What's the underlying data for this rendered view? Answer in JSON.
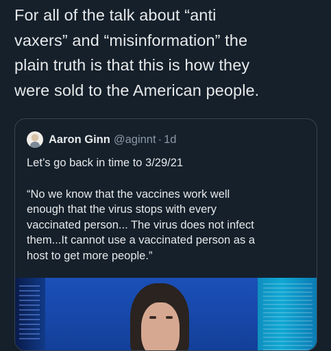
{
  "tweet": {
    "text_lines": [
      "For all of the talk about “anti",
      "vaxers” and “misinformation” the",
      "plain truth is that this is how they",
      "were sold to the American people."
    ]
  },
  "quoted_tweet": {
    "author_name": "Aaron Ginn",
    "author_handle": "@aginnt",
    "separator": "·",
    "time": "1d",
    "line1": "Let’s go back in time to 3/29/21",
    "body_lines": [
      "“No we know that the vaccines work well",
      "enough that the virus stops with every",
      "vaccinated person... The virus does not infect",
      "them...It cannot use a vaccinated person as a",
      "host to get more people.”"
    ]
  },
  "colors": {
    "background": "#15202b",
    "text": "#e7e9ea",
    "secondary_text": "#8b98a5",
    "card_border": "#38444d"
  },
  "icons": {
    "avatar": "profile-photo"
  }
}
